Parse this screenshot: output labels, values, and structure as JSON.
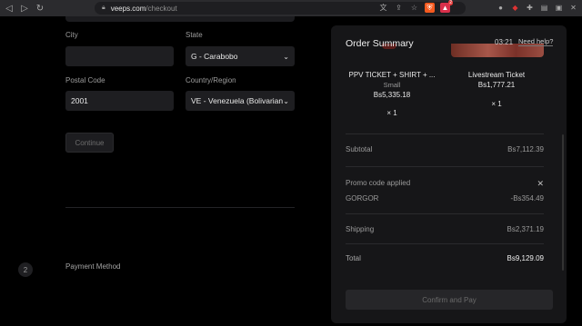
{
  "browser": {
    "url_host": "veeps.com",
    "url_path": "/checkout",
    "ext_badge": "2"
  },
  "form": {
    "city_label": "City",
    "city_value": "",
    "state_label": "State",
    "state_value": "G - Carabobo",
    "postal_label": "Postal Code",
    "postal_value": "2001",
    "country_label": "Country/Region",
    "country_value": "VE - Venezuela (Bolivarian...",
    "continue_label": "Continue"
  },
  "payment_step": {
    "number": "2",
    "label": "Payment Method"
  },
  "summary": {
    "title": "Order Summary",
    "timer": "03:21",
    "help": "Need help?",
    "items": [
      {
        "name": "PPV TICKET + SHIRT + ...",
        "variant": "Small",
        "price": "Bs5,335.18",
        "qty": "× 1"
      },
      {
        "name": "Livestream Ticket",
        "variant": "",
        "price": "Bs1,777.21",
        "qty": "× 1"
      }
    ],
    "subtotal_label": "Subtotal",
    "subtotal_value": "Bs7,112.39",
    "promo_label": "Promo code applied",
    "promo_code": "GORGOR",
    "promo_value": "-Bs354.49",
    "shipping_label": "Shipping",
    "shipping_value": "Bs2,371.19",
    "total_label": "Total",
    "total_value": "Bs9,129.09",
    "confirm_label": "Confirm and Pay"
  }
}
